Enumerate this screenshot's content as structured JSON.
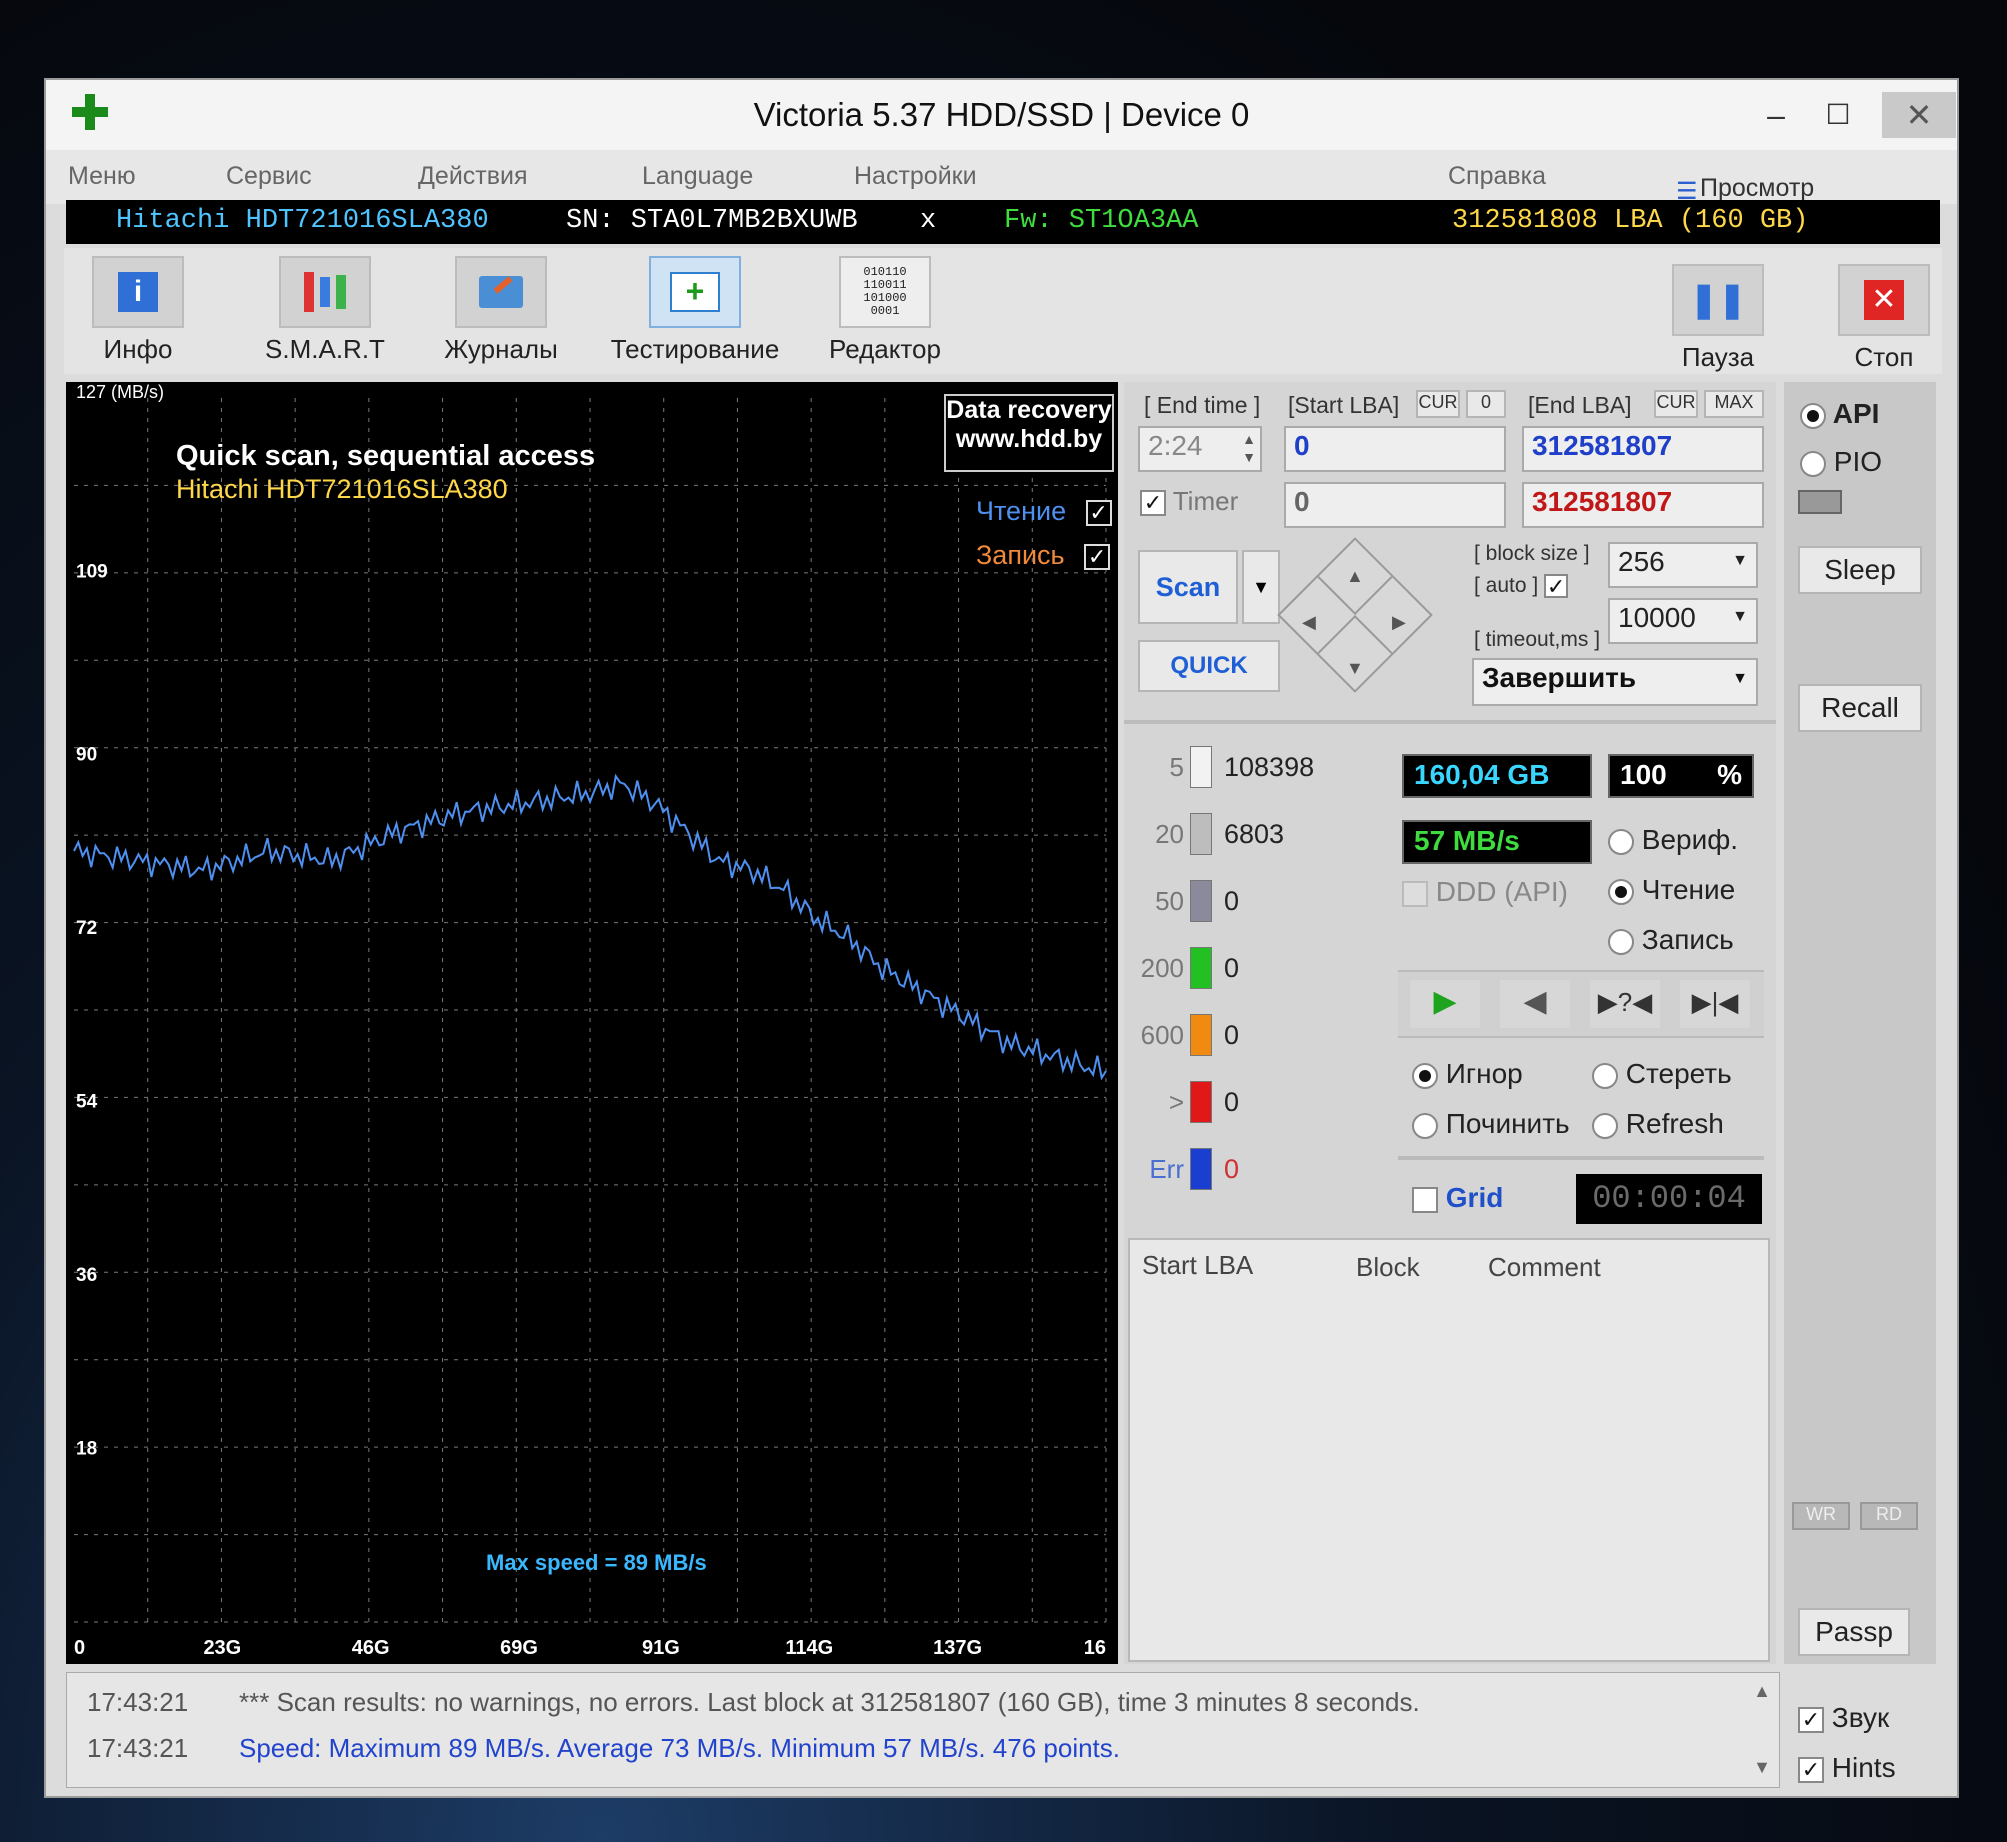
{
  "window": {
    "title": "Victoria 5.37 HDD/SSD | Device 0",
    "minimize": "–",
    "maximize": "☐",
    "close": "✕"
  },
  "menu": {
    "items": [
      "Меню",
      "Сервис",
      "Действия",
      "Language",
      "Настройки",
      "Справка"
    ],
    "buffer": "Просмотр буфера"
  },
  "device": {
    "model": "Hitachi HDT721016SLA380",
    "sn": "SN: STA0L7MB2BXUWB",
    "x": "x",
    "fw": "Fw: ST1OA3AA",
    "lba": "312581808 LBA (160 GB)"
  },
  "toolbar": {
    "info": "Инфо",
    "smart": "S.M.A.R.T",
    "logs": "Журналы",
    "test": "Тестирование",
    "editor": "Редактор",
    "pause": "Пауза",
    "stop": "Стоп",
    "editor_icon_text": "010110\n110011\n101000\n0001"
  },
  "graph": {
    "unit": "127 (MB/s)",
    "title": "Quick scan, sequential access",
    "subtitle": "Hitachi HDT721016SLA380",
    "brand_line1": "Data recovery",
    "brand_line2": "www.hdd.by",
    "read_label": "Чтение",
    "write_label": "Запись",
    "max_speed": "Max speed = 89 MB/s",
    "y_ticks": [
      "109",
      "90",
      "72",
      "54",
      "36",
      "18"
    ],
    "x_ticks": [
      "0",
      "23G",
      "46G",
      "69G",
      "91G",
      "114G",
      "137G",
      "16"
    ],
    "line_color": "#4f8ff0"
  },
  "chart_data": {
    "type": "line",
    "x_unit": "GB",
    "y_unit": "MB/s",
    "xlim": [
      0,
      160
    ],
    "ylim": [
      0,
      127
    ],
    "x": [
      0,
      10,
      20,
      30,
      40,
      50,
      60,
      70,
      80,
      85,
      90,
      95,
      100,
      105,
      110,
      115,
      120,
      125,
      130,
      135,
      140,
      145,
      150,
      155,
      160
    ],
    "y": [
      80,
      79,
      78,
      80,
      79,
      82,
      84,
      85,
      86,
      87,
      85,
      82,
      79,
      78,
      76,
      73,
      71,
      68,
      66,
      64,
      62,
      60,
      59,
      58,
      57
    ]
  },
  "controls": {
    "end_time_label": "[ End time ]",
    "start_lba_label": "[Start LBA]",
    "cur": "CUR",
    "zero": "0",
    "end_lba_label": "[End LBA]",
    "max": "MAX",
    "time_value": "2:24",
    "start_lba": "0",
    "end_lba": "312581807",
    "timer_label": "Timer",
    "timer_start": "0",
    "timer_end": "312581807",
    "scan": "Scan",
    "quick": "QUICK",
    "block_size_label": "[ block size ]",
    "auto_label": "[ auto ]",
    "block_size": "256",
    "timeout_label": "[ timeout,ms ]",
    "timeout": "10000",
    "finish": "Завершить"
  },
  "stats": {
    "rows": [
      {
        "label": "5",
        "count": "108398",
        "color": "#f2f2f2"
      },
      {
        "label": "20",
        "count": "6803",
        "color": "#bdbdbd"
      },
      {
        "label": "50",
        "count": "0",
        "color": "#8a8a9a"
      },
      {
        "label": "200",
        "count": "0",
        "color": "#22c022"
      },
      {
        "label": "600",
        "count": "0",
        "color": "#f08a10"
      },
      {
        "label": ">",
        "count": "0",
        "color": "#e01818"
      },
      {
        "label": "Err",
        "count": "0",
        "color": "#1a3fd0"
      }
    ],
    "size": "160,04 GB",
    "percent": "100",
    "percent_sign": "%",
    "speed": "57 MB/s",
    "ddd": "DDD (API)",
    "verify": "Вериф.",
    "read": "Чтение",
    "write": "Запись",
    "ignore": "Игнор",
    "erase": "Стереть",
    "repair": "Починить",
    "refresh": "Refresh",
    "grid": "Grid",
    "clock": "00:00:04"
  },
  "table": {
    "headers": [
      "Start LBA",
      "Block",
      "Comment"
    ]
  },
  "side": {
    "api": "API",
    "pio": "PIO",
    "sleep": "Sleep",
    "recall": "Recall",
    "wr": "WR",
    "rd": "RD",
    "passp": "Passp",
    "sound": "Звук",
    "hints": "Hints"
  },
  "log": {
    "lines": [
      {
        "time": "17:43:21",
        "text": "*** Scan results: no warnings, no errors. Last block at 312581807 (160 GB), time 3 minutes 8 seconds."
      },
      {
        "time": "17:43:21",
        "text": "Speed: Maximum 89 MB/s. Average 73 MB/s. Minimum 57 MB/s. 476 points."
      }
    ]
  }
}
